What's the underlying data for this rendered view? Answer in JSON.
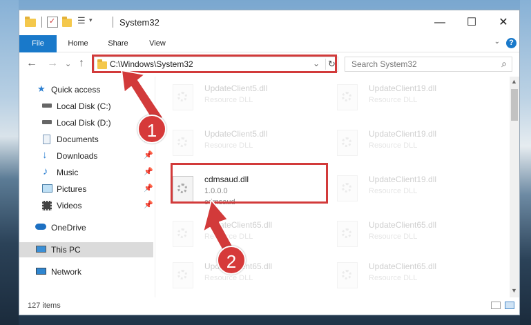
{
  "window": {
    "title": "System32",
    "qat_dropdown_glyph": "▾",
    "controls": {
      "minimize": "—",
      "maximize": "☐",
      "close": "✕"
    }
  },
  "ribbon": {
    "tabs": [
      {
        "label": "File"
      },
      {
        "label": "Home"
      },
      {
        "label": "Share"
      },
      {
        "label": "View"
      }
    ],
    "help_glyph": "?",
    "collapse_glyph": "⌄"
  },
  "navigation": {
    "back_glyph": "←",
    "forward_glyph": "→",
    "recent_glyph": "⌄",
    "up_glyph": "↑",
    "address": "C:\\Windows\\System32",
    "address_dropdown_glyph": "⌄",
    "refresh_glyph": "↻",
    "search_placeholder": "Search System32",
    "search_glyph": "⌕"
  },
  "sidebar": {
    "quick_access": "Quick access",
    "items": [
      {
        "label": "Local Disk (C:)",
        "pinned": true
      },
      {
        "label": "Local Disk (D:)",
        "pinned": false
      },
      {
        "label": "Documents",
        "pinned": true
      },
      {
        "label": "Downloads",
        "pinned": true
      },
      {
        "label": "Music",
        "pinned": true
      },
      {
        "label": "Pictures",
        "pinned": true
      },
      {
        "label": "Videos",
        "pinned": true
      }
    ],
    "pin_glyph": "📌",
    "onedrive": "OneDrive",
    "this_pc": "This PC",
    "network": "Network"
  },
  "files": {
    "left_column": [
      {
        "name": "UpdateClient5.dll",
        "desc": "Resource DLL"
      },
      {
        "name": "UpdateClient5.dll",
        "desc": "Resource DLL"
      },
      {
        "name": "cdmsaud.dll",
        "desc": "1.0.0.0",
        "desc2": "cdmsaud"
      },
      {
        "name": "UpdateClient65.dll",
        "desc": "Resource DLL"
      },
      {
        "name": "UpdateClient65.dll",
        "desc": "Resource DLL"
      }
    ],
    "right_column": [
      {
        "name": "UpdateClient19.dll",
        "desc": "Resource DLL"
      },
      {
        "name": "UpdateClient19.dll",
        "desc": "Resource DLL"
      },
      {
        "name": "UpdateClient19.dll",
        "desc": "Resource DLL"
      },
      {
        "name": "UpdateClient65.dll",
        "desc": "Resource DLL"
      },
      {
        "name": "UpdateClient65.dll",
        "desc": "Resource DLL"
      }
    ]
  },
  "scrollbar": {
    "up_glyph": "▲",
    "down_glyph": "▼"
  },
  "status": {
    "item_count": "127 items"
  },
  "annotations": {
    "step1": "1",
    "step2": "2",
    "color": "#d23a3a"
  }
}
